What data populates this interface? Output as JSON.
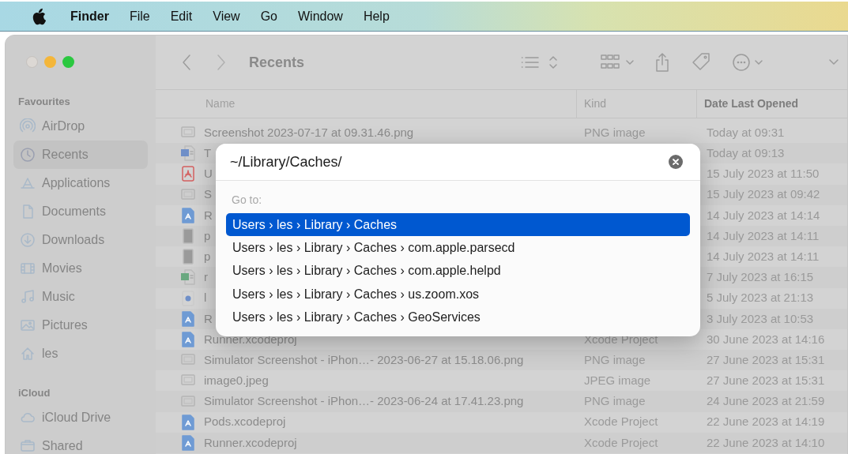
{
  "menu_bar": {
    "app_name": "Finder",
    "menus": [
      "File",
      "Edit",
      "View",
      "Go",
      "Window",
      "Help"
    ]
  },
  "window": {
    "title": "Recents"
  },
  "sidebar": {
    "sections": [
      {
        "heading": "Favourites",
        "items": [
          {
            "label": "AirDrop",
            "selected": false
          },
          {
            "label": "Recents",
            "selected": true
          },
          {
            "label": "Applications",
            "selected": false
          },
          {
            "label": "Documents",
            "selected": false
          },
          {
            "label": "Downloads",
            "selected": false
          },
          {
            "label": "Movies",
            "selected": false
          },
          {
            "label": "Music",
            "selected": false
          },
          {
            "label": "Pictures",
            "selected": false
          },
          {
            "label": "les",
            "selected": false
          }
        ]
      },
      {
        "heading": "iCloud",
        "items": [
          {
            "label": "iCloud Drive",
            "selected": false
          },
          {
            "label": "Shared",
            "selected": false
          }
        ]
      }
    ]
  },
  "table": {
    "columns": [
      {
        "label": "Name",
        "sorted": false
      },
      {
        "label": "Kind",
        "sorted": false
      },
      {
        "label": "Date Last Opened",
        "sorted": true
      }
    ],
    "rows": [
      {
        "kind": "image",
        "name": "Screenshot 2023-07-17 at 09.31.46.png",
        "type": "PNG image",
        "date": "Today at 09:31"
      },
      {
        "kind": "word",
        "name": "T",
        "date": "Today at 09:13"
      },
      {
        "kind": "pdf",
        "name": "U",
        "date": "15 July 2023 at 11:50"
      },
      {
        "kind": "image",
        "name": "S",
        "date": "15 July 2023 at 09:42"
      },
      {
        "kind": "xcode",
        "name": "R",
        "date": "14 July 2023 at 14:14"
      },
      {
        "kind": "document",
        "name": "p",
        "date": "14 July 2023 at 14:11"
      },
      {
        "kind": "document",
        "name": "p",
        "date": "14 July 2023 at 14:11"
      },
      {
        "kind": "sheet",
        "name": "r",
        "date": "7 July 2023 at 16:15"
      },
      {
        "kind": "disc",
        "name": "l",
        "date": "5 July 2023 at 21:13"
      },
      {
        "kind": "xcode",
        "name": "R",
        "date": "3 July 2023 at 10:53"
      },
      {
        "kind": "xcode",
        "name": "Runner.xcodeproj",
        "type": "Xcode Project",
        "date": "30 June 2023 at 14:16"
      },
      {
        "kind": "image",
        "name": "Simulator Screenshot - iPhon…- 2023-06-27 at 15.18.06.png",
        "type": "PNG image",
        "date": "27 June 2023 at 15:31"
      },
      {
        "kind": "image",
        "name": "image0.jpeg",
        "type": "JPEG image",
        "date": "27 June 2023 at 15:31"
      },
      {
        "kind": "image",
        "name": "Simulator Screenshot - iPhon…- 2023-06-24 at 17.41.23.png",
        "type": "PNG image",
        "date": "24 June 2023 at 21:59"
      },
      {
        "kind": "xcode",
        "name": "Pods.xcodeproj",
        "type": "Xcode Project",
        "date": "22 June 2023 at 14:19"
      },
      {
        "kind": "xcode",
        "name": "Runner.xcodeproj",
        "type": "Xcode Project",
        "date": "22 June 2023 at 14:10"
      }
    ]
  },
  "go_to_dialog": {
    "value": "~/Library/Caches/",
    "heading": "Go to:",
    "suggestions": [
      {
        "path": "Users › les › Library › Caches",
        "selected": true
      },
      {
        "path": "Users › les › Library › Caches › com.apple.parsecd",
        "selected": false
      },
      {
        "path": "Users › les › Library › Caches › com.apple.helpd",
        "selected": false
      },
      {
        "path": "Users › les › Library › Caches › us.zoom.xos",
        "selected": false
      },
      {
        "path": "Users › les › Library › Caches › GeoServices",
        "selected": false
      }
    ]
  }
}
